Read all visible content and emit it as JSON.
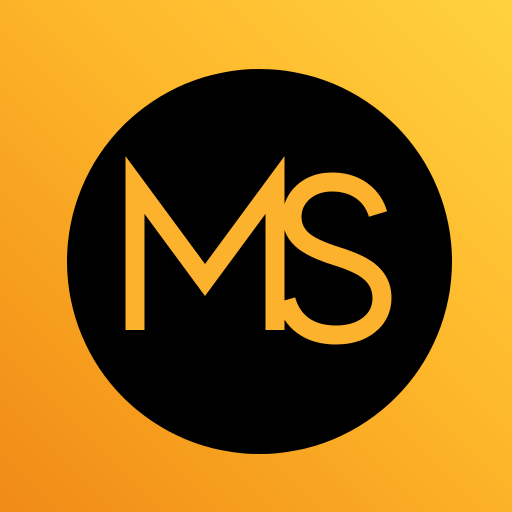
{
  "logo": {
    "monogram": "MS",
    "colors": {
      "background_gradient": [
        "#FFD23F",
        "#FDB62A",
        "#F59A1C",
        "#F08A18"
      ],
      "circle": "#000000",
      "letters": "#FCB22D"
    }
  }
}
